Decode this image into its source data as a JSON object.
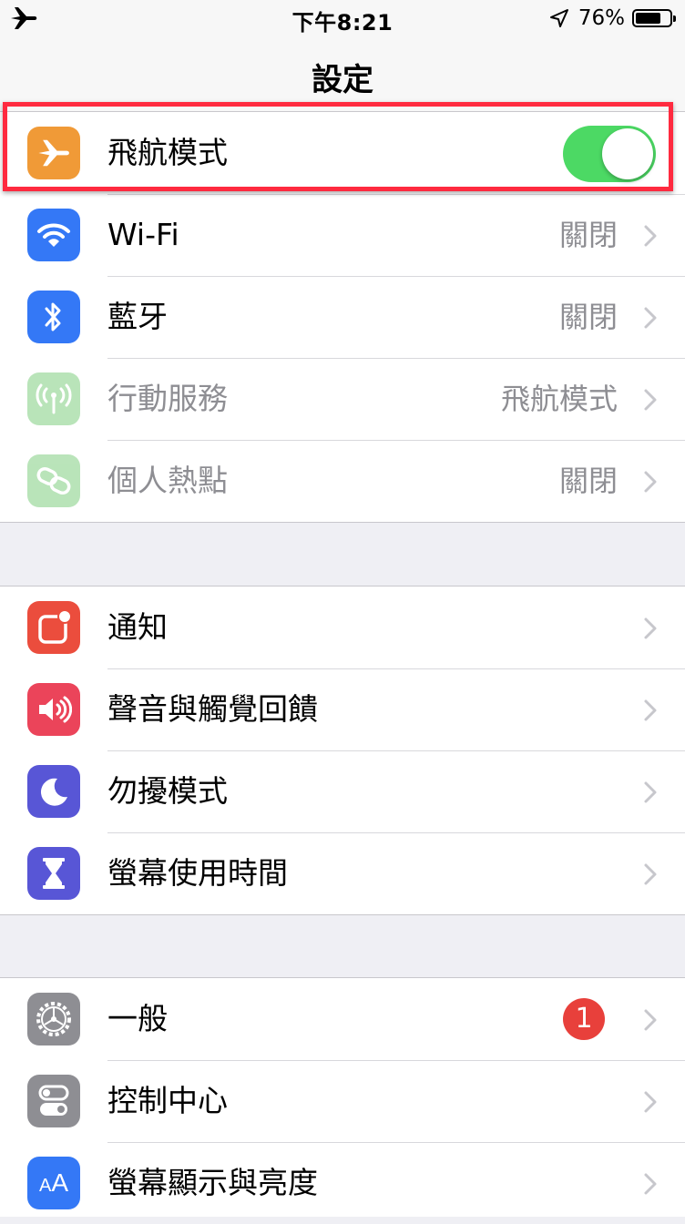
{
  "status_bar": {
    "time": "下午8:21",
    "battery_percent": "76%",
    "battery_level": 0.76,
    "left_icon": "airplane-icon",
    "location_icon": "location-arrow-icon"
  },
  "nav": {
    "title": "設定"
  },
  "colors": {
    "toggle_on": "#4cd964",
    "highlight": "#ff2a3f",
    "badge": "#e8403b",
    "secondary_text": "#8e8e93"
  },
  "groups": [
    {
      "rows": [
        {
          "label": "飛航模式",
          "icon": "airplane-icon",
          "icon_color": "#f09a37",
          "toggle_on": true
        },
        {
          "label": "Wi-Fi",
          "icon": "wifi-icon",
          "icon_color": "#3478f6",
          "value": "關閉"
        },
        {
          "label": "藍牙",
          "icon": "bluetooth-icon",
          "icon_color": "#3478f6",
          "value": "關閉"
        },
        {
          "label": "行動服務",
          "icon": "cellular-icon",
          "icon_color": "#65c466",
          "value": "飛航模式",
          "disabled": true
        },
        {
          "label": "個人熱點",
          "icon": "hotspot-icon",
          "icon_color": "#65c466",
          "value": "關閉",
          "disabled": true
        }
      ]
    },
    {
      "rows": [
        {
          "label": "通知",
          "icon": "notifications-icon",
          "icon_color": "#eb4d3d"
        },
        {
          "label": "聲音與觸覺回饋",
          "icon": "sound-icon",
          "icon_color": "#eb445a"
        },
        {
          "label": "勿擾模式",
          "icon": "moon-icon",
          "icon_color": "#5856d6"
        },
        {
          "label": "螢幕使用時間",
          "icon": "hourglass-icon",
          "icon_color": "#5856d6"
        }
      ]
    },
    {
      "rows": [
        {
          "label": "一般",
          "icon": "gear-icon",
          "icon_color": "#8e8e93",
          "badge": "1"
        },
        {
          "label": "控制中心",
          "icon": "control-center-icon",
          "icon_color": "#8e8e93"
        },
        {
          "label": "螢幕顯示與亮度",
          "icon": "display-brightness-icon",
          "icon_color": "#3478f6",
          "icon_text": "AA"
        }
      ]
    }
  ]
}
